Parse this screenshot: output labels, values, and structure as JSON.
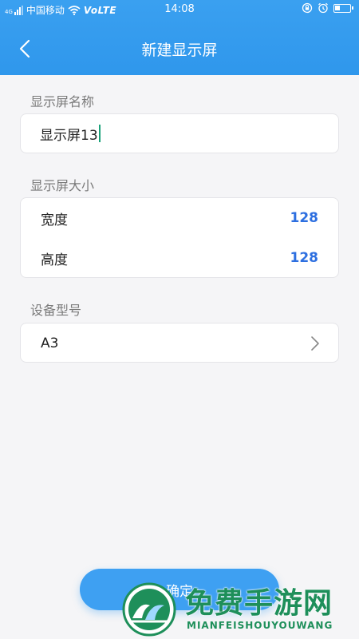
{
  "status_bar": {
    "carrier_indicator": "4G",
    "carrier": "中国移动",
    "network": "VoLTE",
    "time": "14:08",
    "icons": [
      "signal-icon",
      "wifi-icon",
      "lock-rotation-icon",
      "alarm-icon",
      "battery-icon"
    ]
  },
  "header": {
    "title": "新建显示屏",
    "back_icon": "chevron-left-icon",
    "background_color": "#2f97ec"
  },
  "name_section": {
    "label": "显示屏名称",
    "input_value": "显示屏13"
  },
  "size_section": {
    "label": "显示屏大小",
    "width_label": "宽度",
    "width_value": "128",
    "height_label": "高度",
    "height_value": "128"
  },
  "device_section": {
    "label": "设备型号",
    "value": "A3",
    "icon": "chevron-right-icon"
  },
  "confirm_button": {
    "label": "确定",
    "color": "#3ea0f2"
  },
  "watermark": {
    "title": "免费手游网",
    "subtitle": "MIANFEISHOUYOUWANG"
  },
  "colors": {
    "accent": "#2d6fe0",
    "background": "#f5f5f7"
  }
}
